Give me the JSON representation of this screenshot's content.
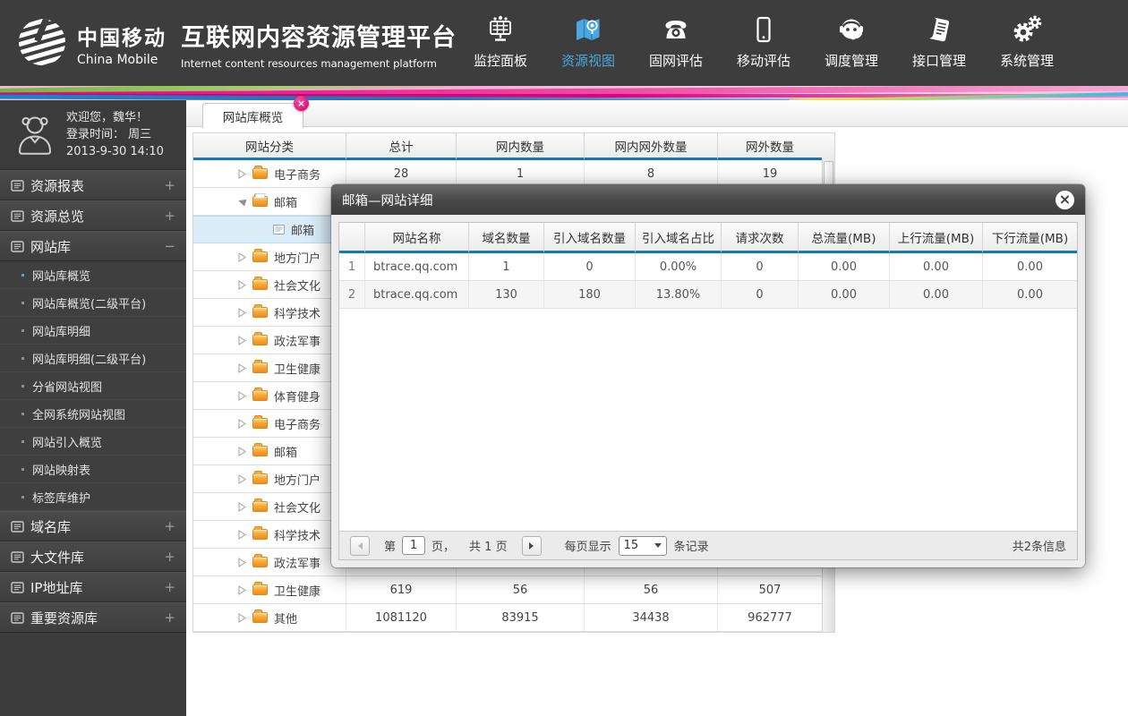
{
  "colors": {
    "header_dark": "#3d3d3d",
    "accent_blue": "#1278b8",
    "nav_active_blue": "#4aa7e0",
    "brand_magenta": "#e5007e",
    "folder_orange": "#f3a23a",
    "selected_row_blue": "#d9ecf8"
  },
  "header": {
    "logo": {
      "brand_cn": "中国移动",
      "brand_en": "China Mobile",
      "title_cn": "互联网内容资源管理平台",
      "title_en": "Internet content resources management platform"
    },
    "nav": [
      {
        "name": "monitor-panel",
        "icon": "dashboard-icon",
        "label": "监控面板",
        "active": false
      },
      {
        "name": "resource-view",
        "icon": "map-icon",
        "label": "资源视图",
        "active": true
      },
      {
        "name": "fixed-net-eval",
        "icon": "phone-icon",
        "label": "固网评估",
        "active": false
      },
      {
        "name": "mobile-eval",
        "icon": "mobile-icon",
        "label": "移动评估",
        "active": false
      },
      {
        "name": "dispatch-mgmt",
        "icon": "headset-icon",
        "label": "调度管理",
        "active": false
      },
      {
        "name": "interface-mgmt",
        "icon": "scroll-icon",
        "label": "接口管理",
        "active": false
      },
      {
        "name": "system-mgmt",
        "icon": "gears-icon",
        "label": "系统管理",
        "active": false
      }
    ]
  },
  "sidebar": {
    "user": {
      "welcome": "欢迎您，魏华！",
      "login_line": "登录时间：  周三",
      "login_datetime": "2013-9-30   14:10"
    },
    "groups": [
      {
        "name": "resource-report",
        "label": "资源报表",
        "toggle": "+"
      },
      {
        "name": "resource-overview",
        "label": "资源总览",
        "toggle": "+"
      },
      {
        "name": "site-library",
        "label": "网站库",
        "toggle": "−",
        "children": [
          {
            "name": "site-lib-overview",
            "label": "网站库概览",
            "active": true
          },
          {
            "name": "site-lib-overview-l2",
            "label": "网站库概览(二级平台)",
            "active": false
          },
          {
            "name": "site-lib-detail",
            "label": "网站库明细",
            "active": false
          },
          {
            "name": "site-lib-detail-l2",
            "label": "网站库明细(二级平台)",
            "active": false
          },
          {
            "name": "province-site-view",
            "label": "分省网站视图",
            "active": false
          },
          {
            "name": "whole-net-site-view",
            "label": "全网系统网站视图",
            "active": false
          },
          {
            "name": "site-import-overview",
            "label": "网站引入概览",
            "active": false
          },
          {
            "name": "site-mapping-table",
            "label": "网站映射表",
            "active": false
          },
          {
            "name": "tag-lib-maintenance",
            "label": "标签库维护",
            "active": false
          }
        ]
      },
      {
        "name": "domain-library",
        "label": "域名库",
        "toggle": "+"
      },
      {
        "name": "big-file-library",
        "label": "大文件库",
        "toggle": "+"
      },
      {
        "name": "ip-library",
        "label": "IP地址库",
        "toggle": "+"
      },
      {
        "name": "key-resource-library",
        "label": "重要资源库",
        "toggle": "+"
      }
    ]
  },
  "main": {
    "tab": {
      "label": "网站库概览",
      "close": "×"
    },
    "table": {
      "headers": [
        "网站分类",
        "总计",
        "网内数量",
        "网内网外数量",
        "网外数量"
      ],
      "rows": [
        {
          "label": "电子商务",
          "state": "collapsed",
          "icon": "folder-icon",
          "indent": 0,
          "selected": false,
          "values": [
            "28",
            "1",
            "8",
            "19"
          ]
        },
        {
          "label": "邮箱",
          "state": "expanded",
          "icon": "folder-open-icon",
          "indent": 0,
          "selected": false,
          "values": [
            "",
            "",
            "",
            ""
          ]
        },
        {
          "label": "邮箱",
          "state": "leaf",
          "icon": "file-icon",
          "indent": 1,
          "selected": true,
          "values": [
            "",
            "",
            "",
            ""
          ]
        },
        {
          "label": "地方门户",
          "state": "collapsed",
          "icon": "folder-icon",
          "indent": 0,
          "selected": false,
          "values": [
            "",
            "",
            "",
            ""
          ]
        },
        {
          "label": "社会文化",
          "state": "collapsed",
          "icon": "folder-icon",
          "indent": 0,
          "selected": false,
          "values": [
            "",
            "",
            "",
            ""
          ]
        },
        {
          "label": "科学技术",
          "state": "collapsed",
          "icon": "folder-icon",
          "indent": 0,
          "selected": false,
          "values": [
            "",
            "",
            "",
            ""
          ]
        },
        {
          "label": "政法军事",
          "state": "collapsed",
          "icon": "folder-icon",
          "indent": 0,
          "selected": false,
          "values": [
            "",
            "",
            "",
            ""
          ]
        },
        {
          "label": "卫生健康",
          "state": "collapsed",
          "icon": "folder-icon",
          "indent": 0,
          "selected": false,
          "values": [
            "",
            "",
            "",
            ""
          ]
        },
        {
          "label": "体育健身",
          "state": "collapsed",
          "icon": "folder-icon",
          "indent": 0,
          "selected": false,
          "values": [
            "",
            "",
            "",
            ""
          ]
        },
        {
          "label": "电子商务",
          "state": "collapsed",
          "icon": "folder-icon",
          "indent": 0,
          "selected": false,
          "values": [
            "",
            "",
            "",
            ""
          ]
        },
        {
          "label": "邮箱",
          "state": "collapsed",
          "icon": "folder-icon",
          "indent": 0,
          "selected": false,
          "values": [
            "",
            "",
            "",
            ""
          ]
        },
        {
          "label": "地方门户",
          "state": "collapsed",
          "icon": "folder-icon",
          "indent": 0,
          "selected": false,
          "values": [
            "",
            "",
            "",
            ""
          ]
        },
        {
          "label": "社会文化",
          "state": "collapsed",
          "icon": "folder-icon",
          "indent": 0,
          "selected": false,
          "values": [
            "",
            "",
            "",
            ""
          ]
        },
        {
          "label": "科学技术",
          "state": "collapsed",
          "icon": "folder-icon",
          "indent": 0,
          "selected": false,
          "values": [
            "",
            "",
            "",
            ""
          ]
        },
        {
          "label": "政法军事",
          "state": "collapsed",
          "icon": "folder-icon",
          "indent": 0,
          "selected": false,
          "values": [
            "",
            "",
            "",
            ""
          ]
        },
        {
          "label": "卫生健康",
          "state": "collapsed",
          "icon": "folder-icon",
          "indent": 0,
          "selected": false,
          "values": [
            "619",
            "56",
            "56",
            "507"
          ]
        },
        {
          "label": "其他",
          "state": "collapsed",
          "icon": "folder-icon",
          "indent": 0,
          "selected": false,
          "values": [
            "1081120",
            "83915",
            "34438",
            "962777"
          ]
        }
      ]
    }
  },
  "modal": {
    "title": "邮箱—网站详细",
    "close": "×",
    "table": {
      "headers": [
        "",
        "网站名称",
        "域名数量",
        "引入域名数量",
        "引入域名占比",
        "请求次数",
        "总流量(MB)",
        "上行流量(MB)",
        "下行流量(MB)"
      ],
      "rows": [
        [
          "1",
          "btrace.qq.com",
          "1",
          "0",
          "0.00%",
          "0",
          "0.00",
          "0.00",
          "0.00"
        ],
        [
          "2",
          "btrace.qq.com",
          "130",
          "180",
          "13.80%",
          "0",
          "0.00",
          "0.00",
          "0.00"
        ]
      ]
    },
    "pagination": {
      "page_label": "第",
      "page_value": "1",
      "page_suffix": "页，",
      "total_pages": "共 1 页",
      "per_page_label": "每页显示",
      "per_page_value": "15",
      "records_suffix": "条记录",
      "total_info": "共2条信息"
    }
  }
}
